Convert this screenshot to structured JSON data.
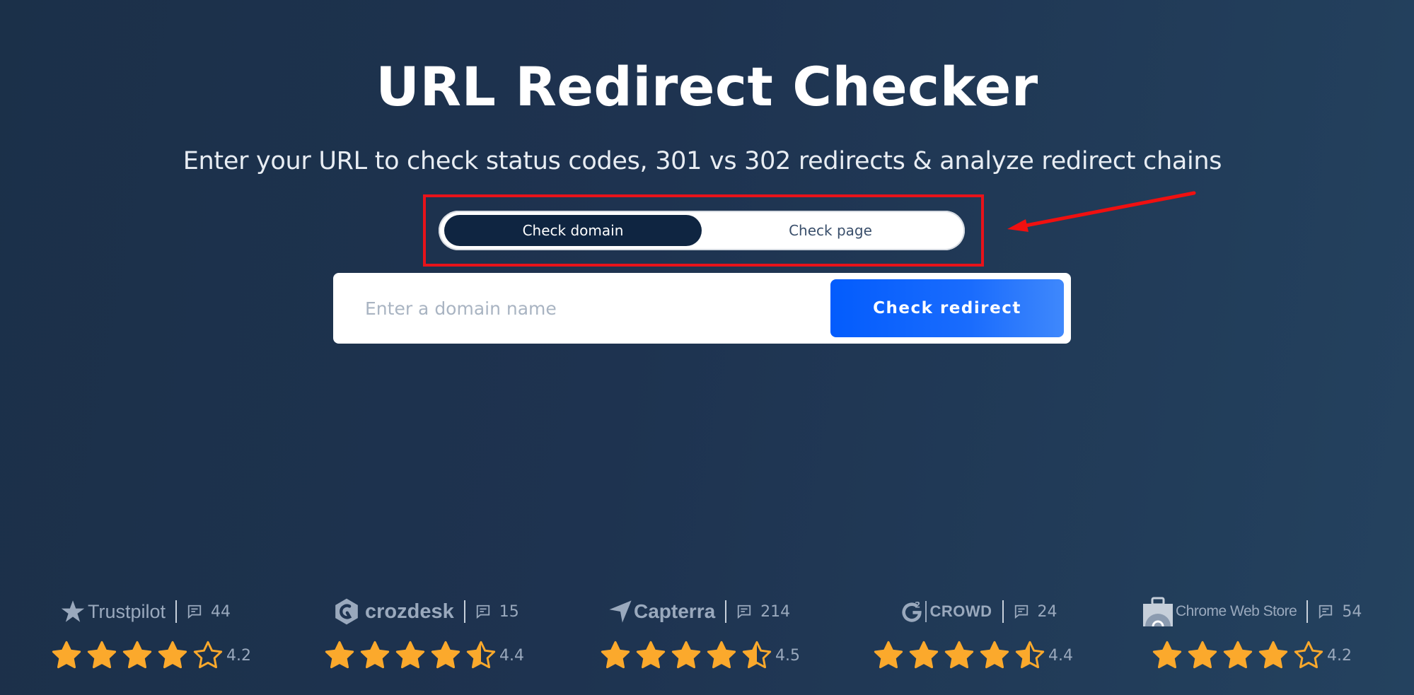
{
  "header": {
    "title": "URL Redirect Checker",
    "subtitle": "Enter your URL to check status codes, 301 vs 302 redirects & analyze redirect chains"
  },
  "mode_toggle": {
    "options": [
      {
        "label": "Check domain",
        "active": true
      },
      {
        "label": "Check page",
        "active": false
      }
    ]
  },
  "search": {
    "value": "",
    "placeholder": "Enter a domain name",
    "button_label": "Check redirect"
  },
  "annotation": {
    "highlight_color": "#e8131a",
    "arrow_icon": "red-arrow-icon"
  },
  "colors": {
    "background": "#1e3350",
    "toggle_active": "#0f2541",
    "button": "#035cfd",
    "star": "#fba92c",
    "muted_text": "#9aa9bd"
  },
  "reviews": [
    {
      "platform": "Trustpilot",
      "icon": "trustpilot-star-icon",
      "count": "44",
      "rating": "4.2",
      "rating_value": 4.2
    },
    {
      "platform": "crozdesk",
      "icon": "crozdesk-logo-icon",
      "count": "15",
      "rating": "4.4",
      "rating_value": 4.4
    },
    {
      "platform": "Capterra",
      "icon": "capterra-arrow-icon",
      "count": "214",
      "rating": "4.5",
      "rating_value": 4.5
    },
    {
      "platform": "CROWD",
      "icon": "g2-logo-icon",
      "count": "24",
      "rating": "4.4",
      "rating_value": 4.4
    },
    {
      "platform": "Chrome Web Store",
      "icon": "chrome-web-store-icon",
      "count": "54",
      "rating": "4.2",
      "rating_value": 4.2
    }
  ]
}
